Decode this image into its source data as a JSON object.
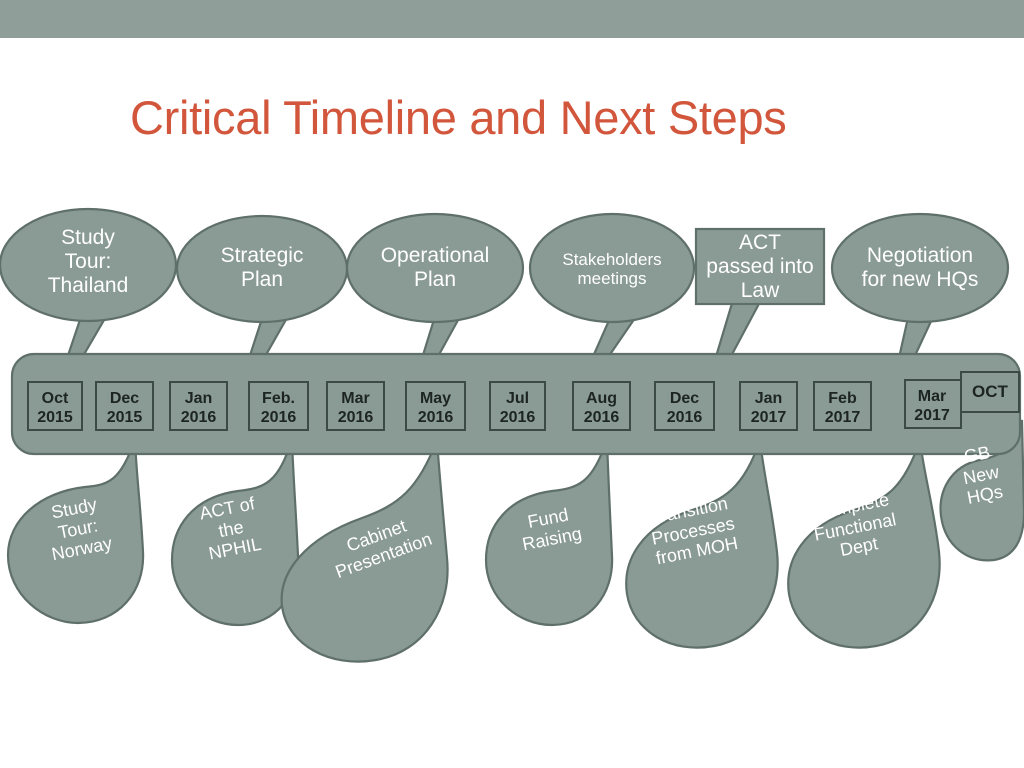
{
  "slide": {
    "title": "Critical Timeline and Next Steps",
    "title_color": "#d2563b",
    "band_color": "#909e99",
    "bubble_fill": "#8a9a94",
    "bubble_stroke": "#5f6f69",
    "background": "#ffffff"
  },
  "timeline": {
    "boxes": [
      {
        "month": "Oct",
        "year": "2015"
      },
      {
        "month": "Dec",
        "year": "2015"
      },
      {
        "month": "Jan",
        "year": "2016"
      },
      {
        "month": "Feb.",
        "year": "2016"
      },
      {
        "month": "Mar",
        "year": "2016"
      },
      {
        "month": "May",
        "year": "2016"
      },
      {
        "month": "Jul",
        "year": "2016"
      },
      {
        "month": "Aug",
        "year": "2016"
      },
      {
        "month": "Dec",
        "year": "2016"
      },
      {
        "month": "Jan",
        "year": "2017"
      },
      {
        "month": "Feb",
        "year": "2017"
      },
      {
        "month": "Mar",
        "year": "2017"
      },
      {
        "month": "OCT",
        "year": ""
      }
    ]
  },
  "callouts_top": [
    {
      "label": "Study\nTour:\nThailand",
      "shape": "oval"
    },
    {
      "label": "Strategic\nPlan",
      "shape": "oval"
    },
    {
      "label": "Operational\nPlan",
      "shape": "oval"
    },
    {
      "label": "Stakeholders\nmeetings",
      "shape": "oval"
    },
    {
      "label": "ACT\npassed into\nLaw",
      "shape": "rectangle"
    },
    {
      "label": "Negotiation\nfor new HQs",
      "shape": "oval"
    }
  ],
  "callouts_bottom": [
    {
      "label": "Study\nTour:\nNorway"
    },
    {
      "label": "ACT of\nthe\nNPHIL"
    },
    {
      "label": "Cabinet\nPresentation"
    },
    {
      "label": "Fund\nRaising"
    },
    {
      "label": "Transition\nProcesses\nfrom MOH"
    },
    {
      "label": "Complete\nFunctional\nDept"
    },
    {
      "label": "GB\nNew\nHQs"
    }
  ]
}
